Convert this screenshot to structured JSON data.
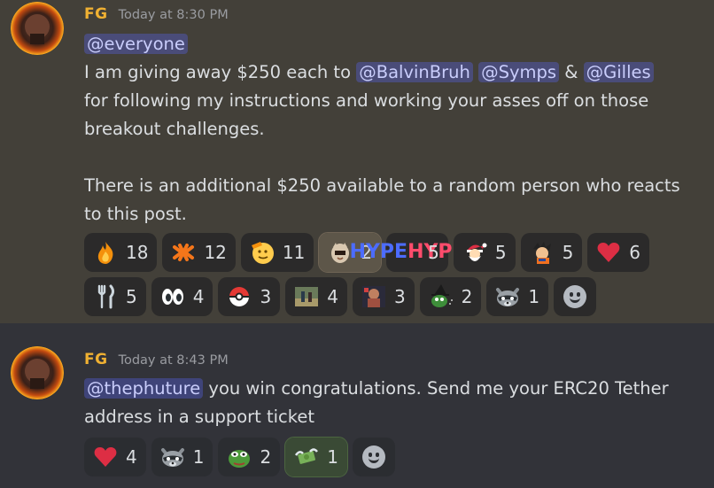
{
  "msg1": {
    "author": "FG",
    "timestamp": "Today at 8:30 PM",
    "mention_everyone": "@everyone",
    "line2_a": "I am giving away $250 each to ",
    "mention_a": "@BalvinBruh",
    "mention_b": "@Symps",
    "amp": " & ",
    "mention_c": "@Gilles",
    "line3": "for following my instructions and working your asses off on those",
    "line4": "breakout challenges.",
    "line5": "There is an additional $250 available to a random person who reacts",
    "line6": "to this post.",
    "reactions": [
      {
        "icon": "fire-emoji",
        "count": "18"
      },
      {
        "icon": "orange-knot-emoji",
        "count": "12"
      },
      {
        "icon": "saluting-face-emoji",
        "count": "11"
      },
      {
        "icon": "cat-mask-emoji",
        "count": "2"
      },
      {
        "icon": "hype-emoji",
        "count": "5"
      },
      {
        "icon": "santa-emoji",
        "count": "5"
      },
      {
        "icon": "anime-character-emoji",
        "count": "5"
      },
      {
        "icon": "heart-emoji",
        "count": "6"
      },
      {
        "icon": "fork-knife-emoji",
        "count": "5"
      },
      {
        "icon": "eyes-emoji",
        "count": "4"
      },
      {
        "icon": "pokeball-emoji",
        "count": "3"
      },
      {
        "icon": "photo-emoji",
        "count": "4"
      },
      {
        "icon": "fighter-emoji",
        "count": "3"
      },
      {
        "icon": "pepe-witch-emoji",
        "count": "2"
      },
      {
        "icon": "raccoon-emoji",
        "count": "1"
      }
    ]
  },
  "msg2": {
    "author": "FG",
    "timestamp": "Today at 8:43 PM",
    "mention": "@thephuture",
    "line1_rest": " you win congratulations. Send me your ERC20 Tether",
    "line2": "address in a support ticket",
    "reactions": [
      {
        "icon": "heart-emoji",
        "count": "4"
      },
      {
        "icon": "raccoon-emoji",
        "count": "1"
      },
      {
        "icon": "pepe-emoji",
        "count": "2"
      },
      {
        "icon": "money-fly-emoji",
        "count": "1"
      }
    ]
  },
  "colors": {
    "author": "#f0b132",
    "mention_bg": "#4a4f8a",
    "highlight_bg": "#434039"
  }
}
